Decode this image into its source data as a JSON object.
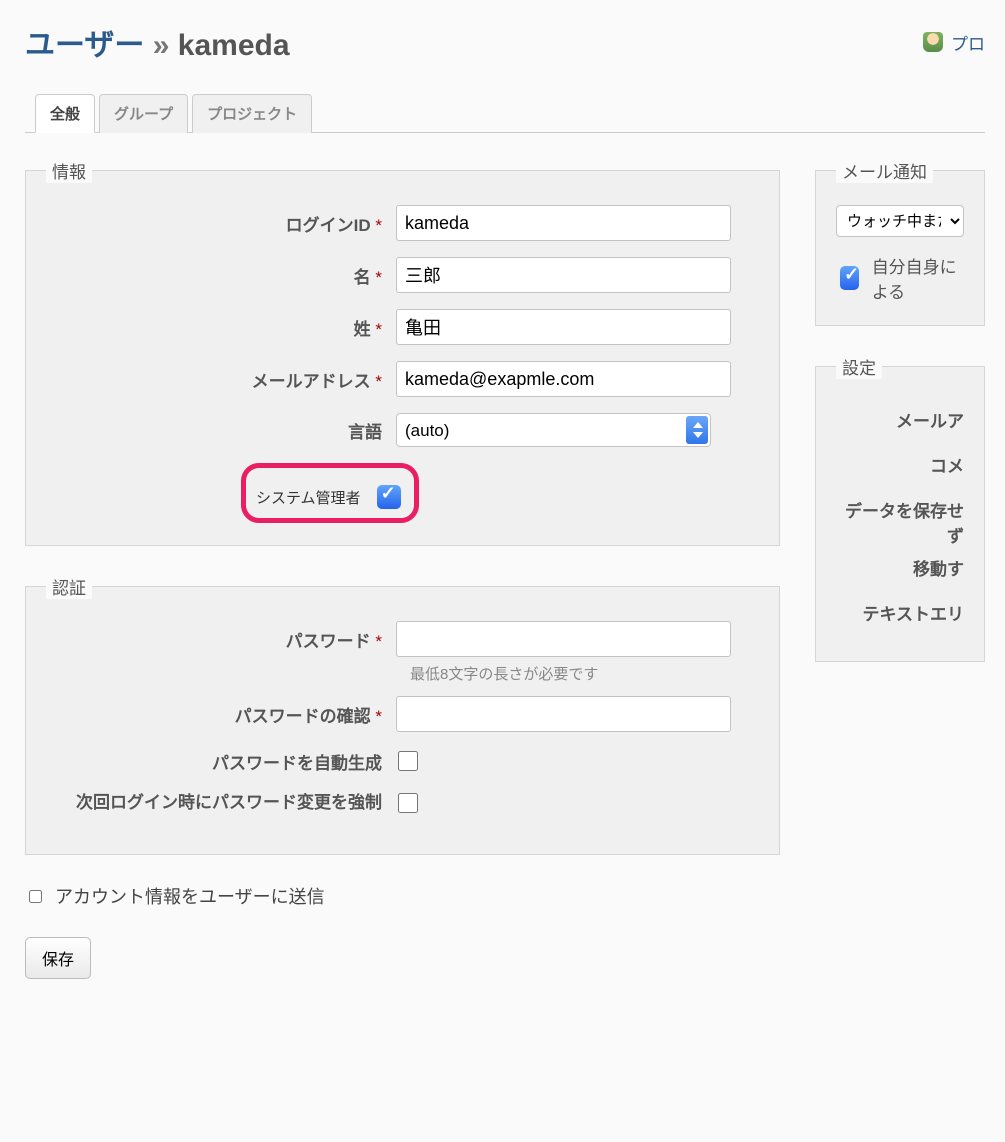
{
  "header": {
    "breadcrumb_link": "ユーザー",
    "arrow": "»",
    "username": "kameda",
    "profile_link": "プロ"
  },
  "tabs": {
    "general": "全般",
    "groups": "グループ",
    "projects": "プロジェクト"
  },
  "info": {
    "legend": "情報",
    "login_id_label": "ログインID",
    "login_id_value": "kameda",
    "firstname_label": "名",
    "firstname_value": "三郎",
    "lastname_label": "姓",
    "lastname_value": "亀田",
    "email_label": "メールアドレス",
    "email_value": "kameda@exapmle.com",
    "language_label": "言語",
    "language_value": "(auto)",
    "admin_label": "システム管理者"
  },
  "auth": {
    "legend": "認証",
    "password_label": "パスワード",
    "password_hint": "最低8文字の長さが必要です",
    "password_confirm_label": "パスワードの確認",
    "generate_label": "パスワードを自動生成",
    "force_change_label": "次回ログイン時にパスワード変更を強制"
  },
  "bottom": {
    "send_info_label": "アカウント情報をユーザーに送信",
    "save_button": "保存"
  },
  "mail": {
    "legend": "メール通知",
    "select_value": "ウォッチ中または自",
    "no_self_notified": "自分自身による"
  },
  "settings": {
    "legend": "設定",
    "mail_address": "メールア",
    "comment": "コメ",
    "data_warn": "データを保存せず",
    "data_warn_2": "移動す",
    "textarea": "テキストエリ"
  }
}
